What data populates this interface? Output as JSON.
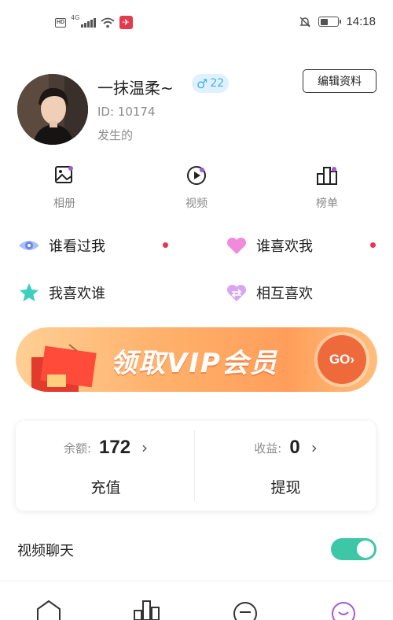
{
  "status_bar": {
    "network_badge": "HD",
    "network_type": "4G",
    "time": "14:18",
    "battery_level": 0.45
  },
  "profile": {
    "username": "一抹温柔~",
    "gender_symbol": "♂",
    "age": "22",
    "user_id": "ID: 10174",
    "bio": "发生的",
    "edit_button": "编辑资料"
  },
  "quick_links": [
    {
      "label": "相册",
      "icon": "album-icon"
    },
    {
      "label": "视频",
      "icon": "video-icon"
    },
    {
      "label": "榜单",
      "icon": "ranking-icon"
    }
  ],
  "menu": [
    {
      "label": "谁看过我",
      "icon": "eye-icon",
      "has_dot": true
    },
    {
      "label": "谁喜欢我",
      "icon": "heart-icon",
      "has_dot": true
    },
    {
      "label": "我喜欢谁",
      "icon": "star-icon",
      "has_dot": false
    },
    {
      "label": "相互喜欢",
      "icon": "mutual-heart-icon",
      "has_dot": false
    }
  ],
  "vip_banner": {
    "title": "领取VIP会员",
    "go_label": "GO"
  },
  "balance": {
    "balance_label": "余额:",
    "balance_value": "172",
    "recharge_label": "充值",
    "earnings_label": "收益:",
    "earnings_value": "0",
    "withdraw_label": "提现",
    "arrow": "›"
  },
  "settings": {
    "video_chat_label": "视频聊天",
    "video_chat_enabled": true
  },
  "bottom_nav": [
    {
      "icon": "home-icon"
    },
    {
      "icon": "chart-icon"
    },
    {
      "icon": "message-icon"
    },
    {
      "icon": "profile-icon",
      "active": true
    }
  ],
  "colors": {
    "accent_green": "#3ec7a7",
    "badge_blue": "#46aef0",
    "dot_red": "#e5374a",
    "vip_orange": "#ff9e5a",
    "active_tab": "#a35ad6"
  }
}
